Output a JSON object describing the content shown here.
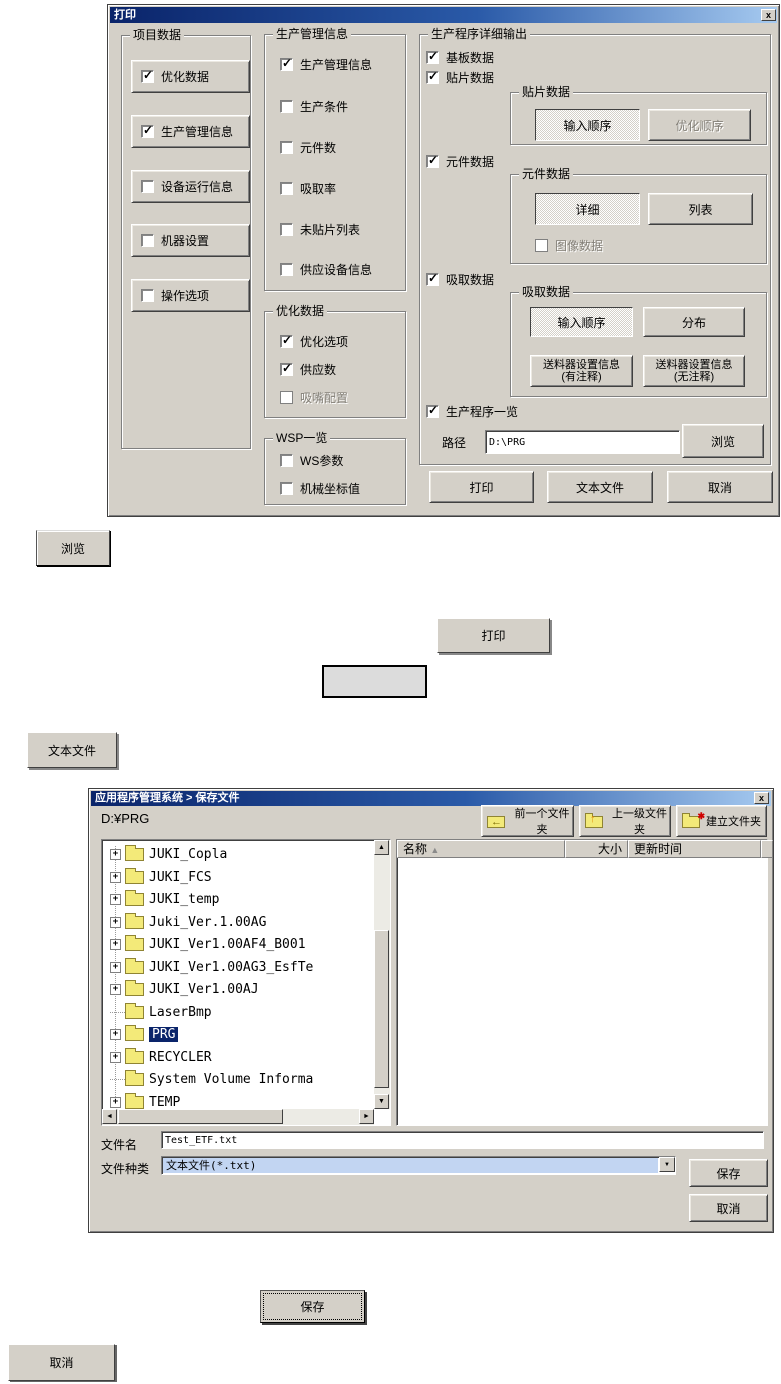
{
  "icons": {
    "close": "x",
    "sort_asc": "▲",
    "expand_plus": "+",
    "arrow_up": "▲",
    "arrow_down": "▼",
    "arrow_left": "◄",
    "arrow_right": "►",
    "combo_down": "▼",
    "back_arrow": "←",
    "up_arrow": "↑",
    "new_spark": "✱"
  },
  "colors": {
    "dialog_bg": "#D4D0C8",
    "titlebar_left": "#0A246A",
    "titlebar_right": "#A6CAF0",
    "selection": "#0A246A",
    "combo_highlight": "#C2D5F2",
    "folder_yellow": "#F3EA79"
  },
  "print_dialog": {
    "title": "打印",
    "item_data": {
      "label": "项目数据",
      "buttons": [
        {
          "label": "优化数据",
          "checked": true
        },
        {
          "label": "生产管理信息",
          "checked": true
        },
        {
          "label": "设备运行信息",
          "checked": false
        },
        {
          "label": "机器设置",
          "checked": false
        },
        {
          "label": "操作选项",
          "checked": false
        }
      ]
    },
    "prod_mgmt": {
      "label": "生产管理信息",
      "checks": [
        {
          "label": "生产管理信息",
          "checked": true
        },
        {
          "label": "生产条件",
          "checked": false
        },
        {
          "label": "元件数",
          "checked": false
        },
        {
          "label": "吸取率",
          "checked": false
        },
        {
          "label": "未贴片列表",
          "checked": false
        },
        {
          "label": "供应设备信息",
          "checked": false
        }
      ]
    },
    "optimize": {
      "label": "优化数据",
      "checks": [
        {
          "label": "优化选项",
          "checked": true
        },
        {
          "label": "供应数",
          "checked": true
        },
        {
          "label": "吸嘴配置",
          "checked": false,
          "disabled": true
        }
      ]
    },
    "wsp": {
      "label": "WSP一览",
      "checks": [
        {
          "label": "WS参数",
          "checked": false
        },
        {
          "label": "机械坐标值",
          "checked": false
        }
      ]
    },
    "detail_output": {
      "label": "生产程序详细输出",
      "board_check": "基板数据",
      "placement_check": "贴片数据",
      "placement_group": {
        "label": "贴片数据",
        "buttons": [
          {
            "label": "输入顺序",
            "selected": true
          },
          {
            "label": "优化顺序",
            "disabled": true
          }
        ]
      },
      "component_check": "元件数据",
      "component_group": {
        "label": "元件数据",
        "buttons": [
          {
            "label": "详细",
            "selected": true
          },
          {
            "label": "列表"
          }
        ],
        "image_check": "图像数据"
      },
      "pickup_check": "吸取数据",
      "pickup_group": {
        "label": "吸取数据",
        "buttons_row1": [
          {
            "label": "输入顺序",
            "selected": true
          },
          {
            "label": "分布"
          }
        ],
        "buttons_row2": [
          {
            "line1": "送料器设置信息",
            "line2": "(有注释)"
          },
          {
            "line1": "送料器设置信息",
            "line2": "(无注释)"
          }
        ]
      },
      "program_list_check": "生产程序一览",
      "path": {
        "label": "路径",
        "value": "D:\\PRG",
        "browse_label": "浏览"
      }
    },
    "footer_buttons": [
      {
        "label": "打印"
      },
      {
        "label": "文本文件"
      },
      {
        "label": "取消"
      }
    ]
  },
  "floating": {
    "browse_label": "浏览",
    "print_label": "打印",
    "textfile_label": "文本文件",
    "save_label": "保存",
    "cancel_label": "取消"
  },
  "save_dialog": {
    "title": "应用程序管理系统 > 保存文件",
    "path": "D:¥PRG",
    "toolbar": [
      {
        "label": "前一个文件夹"
      },
      {
        "label": "上一级文件夹"
      },
      {
        "label": "建立文件夹"
      }
    ],
    "list_header": {
      "name": "名称",
      "size": "大小",
      "modified": "更新时间"
    },
    "tree": [
      {
        "label": "JUKI_Copla",
        "expand": true
      },
      {
        "label": "JUKI_FCS",
        "expand": true
      },
      {
        "label": "JUKI_temp",
        "expand": true
      },
      {
        "label": "Juki_Ver.1.00AG",
        "expand": true
      },
      {
        "label": "JUKI_Ver1.00AF4_B001",
        "expand": true
      },
      {
        "label": "JUKI_Ver1.00AG3_EsfTe",
        "expand": true
      },
      {
        "label": "JUKI_Ver1.00AJ",
        "expand": true
      },
      {
        "label": "LaserBmp",
        "expand": false
      },
      {
        "label": "PRG",
        "expand": true,
        "selected": true
      },
      {
        "label": "RECYCLER",
        "expand": true
      },
      {
        "label": "System Volume Informa",
        "expand": false
      },
      {
        "label": "TEMP",
        "expand": true
      }
    ],
    "filename": {
      "label": "文件名",
      "value": "Test_ETF.txt"
    },
    "filetype": {
      "label": "文件种类",
      "value": "文本文件(*.txt)"
    },
    "save_label": "保存",
    "cancel_label": "取消"
  }
}
